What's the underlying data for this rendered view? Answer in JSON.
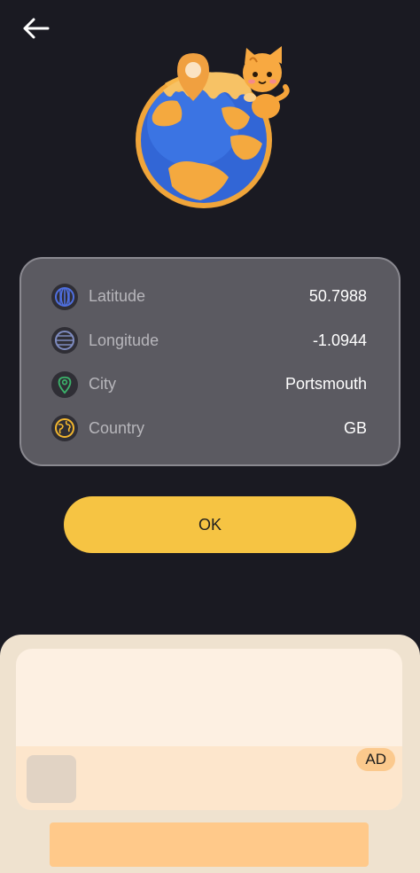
{
  "nav": {
    "back_icon": "arrow-left-icon"
  },
  "hero": {
    "image": "globe-with-location-pin-and-cat-illustration"
  },
  "location": {
    "rows": [
      {
        "icon": "latitude-globe-icon",
        "label": "Latitude",
        "value": "50.7988"
      },
      {
        "icon": "longitude-globe-icon",
        "label": "Longitude",
        "value": "-1.0944"
      },
      {
        "icon": "map-pin-icon",
        "label": "City",
        "value": "Portsmouth"
      },
      {
        "icon": "earth-icon",
        "label": "Country",
        "value": "GB"
      }
    ]
  },
  "actions": {
    "ok_label": "OK"
  },
  "ad": {
    "badge": "AD"
  },
  "colors": {
    "background": "#1a1a22",
    "card": "#5b5a61",
    "accent": "#f6c443",
    "latitude_icon": "#4f6fe0",
    "longitude_icon": "#7e8bbf",
    "city_icon": "#3bb26a",
    "country_icon": "#f2b62e"
  }
}
